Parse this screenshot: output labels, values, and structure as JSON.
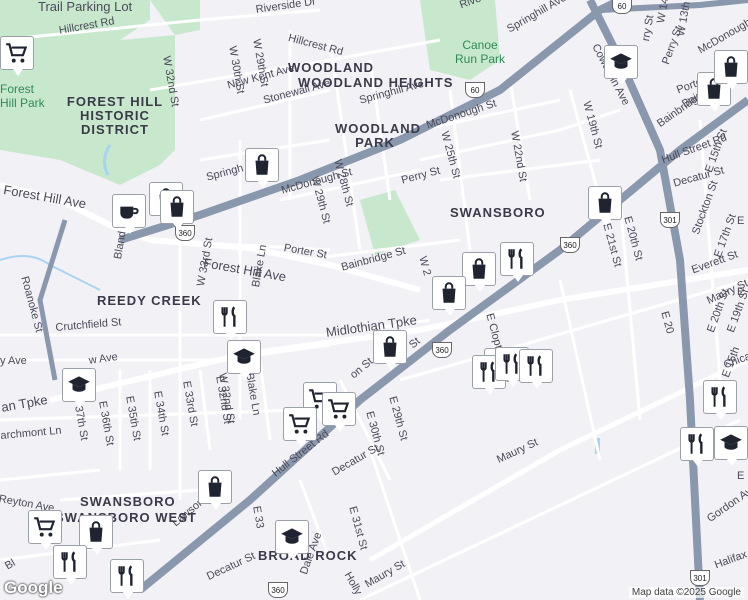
{
  "colors": {
    "background": "#f2f1f6",
    "park": "#c8e8cd",
    "water": "#a9d3f2",
    "highway": "#8a98ae",
    "road": "#ffffff",
    "pin_icon": "#1f2430"
  },
  "labels": {
    "trail_parking": "Trail Parking Lot",
    "riverside": "Riverside Dr",
    "hillcrest1": "Hillcrest Rd",
    "hillcrest2": "Hillcrest Rd",
    "springhill1": "Springhill Ave",
    "springhill2": "Springhill Ave",
    "springhill3": "Springh",
    "w32nd": "W 32nd St",
    "w30th": "W 30th St",
    "w29th_top": "W 29th St",
    "w28th_top": "W 28th St",
    "newkent": "New Kent Ave",
    "stonewall": "Stonewall Ave",
    "woodland_heights": "WOODLAND HEIGHTS",
    "canoe_run": "Canoe Run Park",
    "forest_hill_park": "Forest Hill Park",
    "forest_hill_historic": "FOREST HILL HISTORIC DISTRICT",
    "woodland_park": "WOODLAND PARK",
    "mcdonough1": "McDonough St",
    "mcdonough2": "McDonough St",
    "mcdonough3": "McDonough St",
    "w25th": "W 25th St",
    "w22nd": "W 22nd St",
    "w19th": "W 19th St",
    "w14th": "W 14th St",
    "w13th": "W 13th St",
    "perry1": "Perry St",
    "perry2": "Perry St",
    "porter1": "Porter St",
    "porter2": "Porter St",
    "w28th": "W 28th St",
    "w29th": "W 29th St",
    "swansboro": "SWANSBORO",
    "bainbridge1": "Bainbridge St",
    "bainbridge2": "Bainbridge St",
    "hull1": "Hull Street Rd",
    "hull2": "Hull Street Rd",
    "forest_hill_ave1": "Forest Hill Ave",
    "forest_hill_ave2": "Forest Hill Ave",
    "decatur1": "Decatur St",
    "decatur2": "Decatur St",
    "decatur3": "Decatur St",
    "stockton": "Stockton St",
    "e15th": "E 15th St",
    "e17th": "E 17th St",
    "e19th": "E 19th St",
    "e20th_right": "E 20th St",
    "e20th": "E 20th St",
    "e21st": "E 21st St",
    "everett": "Everett St",
    "maury1": "Maury St",
    "maury2": "Maury St",
    "maury3": "Maury St",
    "reedy_creek": "REEDY CREEK",
    "roanoke": "Roanoke St",
    "bland": "Bland St",
    "w33rd": "W 33rd St",
    "blake1": "Blake Ln",
    "blake2": "Blake Ln",
    "w32nd_low": "W 32nd St",
    "crutchfield": "Crutchfield St",
    "midlothian": "Midlothian Tpke",
    "midlothian_left": "an Tpke",
    "w2": "W 2",
    "e_clopton": "E Clopton",
    "e29th": "E 29th St",
    "e30th": "E 30th St",
    "e31st": "E 31st St",
    "e32nd": "E 32nd St",
    "e33rd": "E 33rd St",
    "e34th": "E 34th St",
    "e35th": "E 35th St",
    "e36th": "E 36th St",
    "e37th": "37th St",
    "e33": "E 33",
    "larchmont": "archmont Ln",
    "reyton": "Reyton Ave",
    "lawson": "Lawson St",
    "decatur_low": "Decatur St",
    "swansboro_west": "SWANSBORO WEST",
    "broad_rock": "BROAD ROCK",
    "holly": "Holly",
    "dale": "Dale Ave",
    "w_ave": "w Ave",
    "on_st": "on St",
    "e_st": "St",
    "chicago": "Chicag",
    "halifax": "Halifax A",
    "gordon": "Gordon Ave",
    "e_low": "E",
    "cowardin": "Cowardin Ave",
    "rive": "Rive",
    "bainbri_right": "Bainbri",
    "e_right": "E",
    "e_right2": "E",
    "e20_right": "E 20",
    "e15_low": "E 15th",
    "bl": "Bl",
    "y_ave": "y Ave",
    "e3_low": "E 3",
    "rry": "rry St"
  },
  "shields": [
    "60",
    "60",
    "360",
    "360",
    "360",
    "301",
    "301",
    "360"
  ],
  "attribution": "Map data ©2025 Google",
  "logo": "Google",
  "pins": [
    {
      "icon": "cart-icon"
    },
    {
      "icon": "school-icon"
    },
    {
      "icon": "bag-icon"
    },
    {
      "icon": "bag-icon"
    },
    {
      "icon": "bag-icon"
    },
    {
      "icon": "cup-icon"
    },
    {
      "icon": "bag-icon"
    },
    {
      "icon": "bag-icon"
    },
    {
      "icon": "bag-icon"
    },
    {
      "icon": "restaurant-icon"
    },
    {
      "icon": "bag-icon"
    },
    {
      "icon": "restaurant-icon"
    },
    {
      "icon": "bag-icon"
    },
    {
      "icon": "school-icon"
    },
    {
      "icon": "restaurant-icon"
    },
    {
      "icon": "school-icon"
    },
    {
      "icon": "bag-icon"
    },
    {
      "icon": "restaurant-icon"
    },
    {
      "icon": "restaurant-icon"
    },
    {
      "icon": "restaurant-icon"
    },
    {
      "icon": "cart-icon"
    },
    {
      "icon": "cart-icon"
    },
    {
      "icon": "restaurant-icon"
    },
    {
      "icon": "restaurant-icon"
    },
    {
      "icon": "school-icon"
    },
    {
      "icon": "bag-icon"
    },
    {
      "icon": "cart-icon"
    },
    {
      "icon": "bag-icon"
    },
    {
      "icon": "restaurant-icon"
    },
    {
      "icon": "school-icon"
    },
    {
      "icon": "restaurant-icon"
    },
    {
      "icon": "cart-icon"
    }
  ]
}
